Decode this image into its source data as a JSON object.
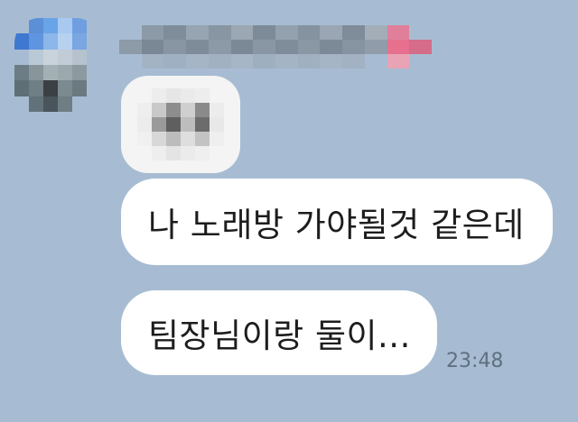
{
  "messages": [
    {
      "text": "나 노래방 가야될것 같은데"
    },
    {
      "text": "팀장님이랑 둘이..."
    }
  ],
  "timestamp": "23:48",
  "colors": {
    "chat_background": "#a7bcd2",
    "bubble_background": "#ffffff",
    "timestamp_color": "#5f6f80"
  },
  "icons": {
    "avatar": "blurred-profile-picture",
    "sender_name": "blurred-sender-name",
    "sticker": "blurred-emoji-sticker"
  }
}
